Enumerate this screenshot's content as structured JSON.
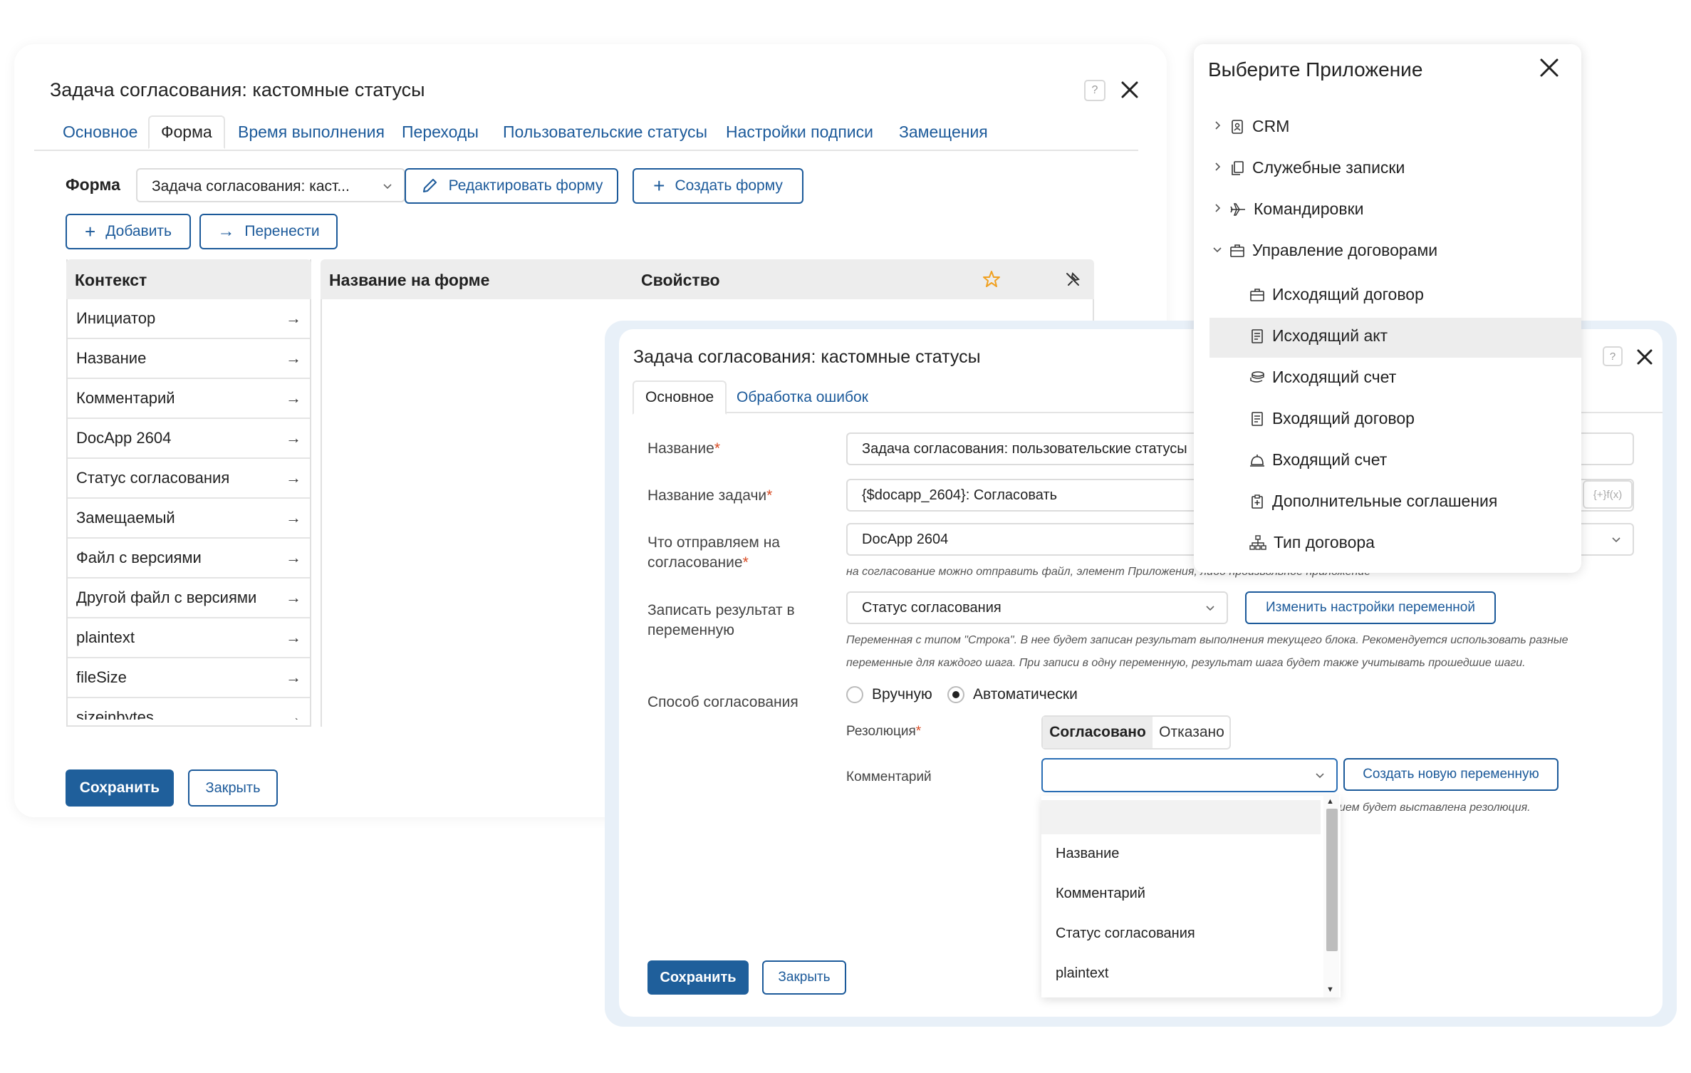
{
  "window1": {
    "title": "Задача согласования: кастомные статусы",
    "tabs": [
      {
        "label": "Основное"
      },
      {
        "label": "Форма"
      },
      {
        "label": "Время выполнения"
      },
      {
        "label": "Переходы"
      },
      {
        "label": "Пользовательские статусы"
      },
      {
        "label": "Настройки подписи"
      },
      {
        "label": "Замещения"
      }
    ],
    "active_tab": "Форма",
    "form_label": "Форма",
    "form_select_value": "Задача согласования: каст...",
    "edit_form_label": "Редактировать форму",
    "create_form_label": "Создать форму",
    "add_label": "Добавить",
    "move_label": "Перенести",
    "context_header": "Контекст",
    "context_items": [
      "Инициатор",
      "Название",
      "Комментарий",
      "DocApp 2604",
      "Статус согласования",
      "Замещаемый",
      "Файл с версиями",
      "Другой файл с версиями",
      "plaintext",
      "fileSize",
      "sizeinbytes"
    ],
    "arrow_glyph": "→",
    "col_name_on_form": "Название на форме",
    "col_property": "Свойство",
    "save_label": "Сохранить",
    "close_label": "Закрыть"
  },
  "window2": {
    "title": "Задача согласования: кастомные статусы",
    "tabs": [
      {
        "label": "Основное"
      },
      {
        "label": "Обработка ошибок"
      }
    ],
    "active_tab": "Основное",
    "name_label": "Название",
    "name_value": "Задача согласования: пользовательские статусы",
    "task_name_label": "Название задачи",
    "task_name_value": "{$docapp_2604}: Согласовать",
    "fx_label": "{+}f(x)",
    "send_label_1": "Что отправляем на",
    "send_label_2": "согласование",
    "send_value": "DocApp 2604",
    "send_hint": "на согласование можно отправить файл, элемент Приложения, либо произвольное приложение",
    "result_label_1": "Записать результат в",
    "result_label_2": "переменную",
    "result_value": "Статус согласования",
    "change_var_label": "Изменить настройки переменной",
    "result_hint_1": "Переменная с типом \"Строка\". В нее будет записан результат выполнения текущего блока. Рекомендуется использовать разные",
    "result_hint_2": "переменные для каждого шага. При записи в одну переменную, результат шага будет также учитывать прошедшие шаги.",
    "method_label": "Способ согласования",
    "manual_label": "Вручную",
    "auto_label": "Автоматически",
    "method_selected": "Автоматически",
    "resolution_label": "Резолюция",
    "approved_label": "Согласовано",
    "rejected_label": "Отказано",
    "resolution_selected": "Согласовано",
    "comment_label": "Комментарий",
    "comment_value": "",
    "create_var_label": "Создать новую переменную",
    "comment_hint": "ием будет выставлена резолюция.",
    "dropdown_options": [
      "",
      "Название",
      "Комментарий",
      "Статус согласования",
      "plaintext"
    ],
    "save_label": "Сохранить",
    "close_label": "Закрыть"
  },
  "window3": {
    "title": "Выберите Приложение",
    "items": [
      {
        "label": "CRM",
        "icon": "contact-card-icon",
        "level": 0,
        "expandable": true,
        "expanded": false
      },
      {
        "label": "Служебные записки",
        "icon": "copy-pages-icon",
        "level": 0,
        "expandable": true,
        "expanded": false
      },
      {
        "label": "Командировки",
        "icon": "airplane-icon",
        "level": 0,
        "expandable": true,
        "expanded": false
      },
      {
        "label": "Управление договорами",
        "icon": "briefcase-icon",
        "level": 0,
        "expandable": true,
        "expanded": true
      },
      {
        "label": "Исходящий договор",
        "icon": "briefcase-icon",
        "level": 1,
        "expandable": false
      },
      {
        "label": "Исходящий акт",
        "icon": "document-icon",
        "level": 1,
        "expandable": false,
        "selected": true
      },
      {
        "label": "Исходящий счет",
        "icon": "coins-icon",
        "level": 1,
        "expandable": false
      },
      {
        "label": "Входящий договор",
        "icon": "document-icon",
        "level": 1,
        "expandable": false
      },
      {
        "label": "Входящий счет",
        "icon": "service-bell-icon",
        "level": 1,
        "expandable": false
      },
      {
        "label": "Дополнительные соглашения",
        "icon": "clipboard-plus-icon",
        "level": 1,
        "expandable": false
      },
      {
        "label": "Тип договора",
        "icon": "hierarchy-icon",
        "level": 1,
        "expandable": false
      }
    ]
  },
  "colors": {
    "accent": "#1c5a9a",
    "primary_button": "#1f5f9b",
    "required": "#d84a22",
    "header_bg": "#ededed",
    "selected_bg": "#ededed",
    "star": "#f0a020"
  }
}
